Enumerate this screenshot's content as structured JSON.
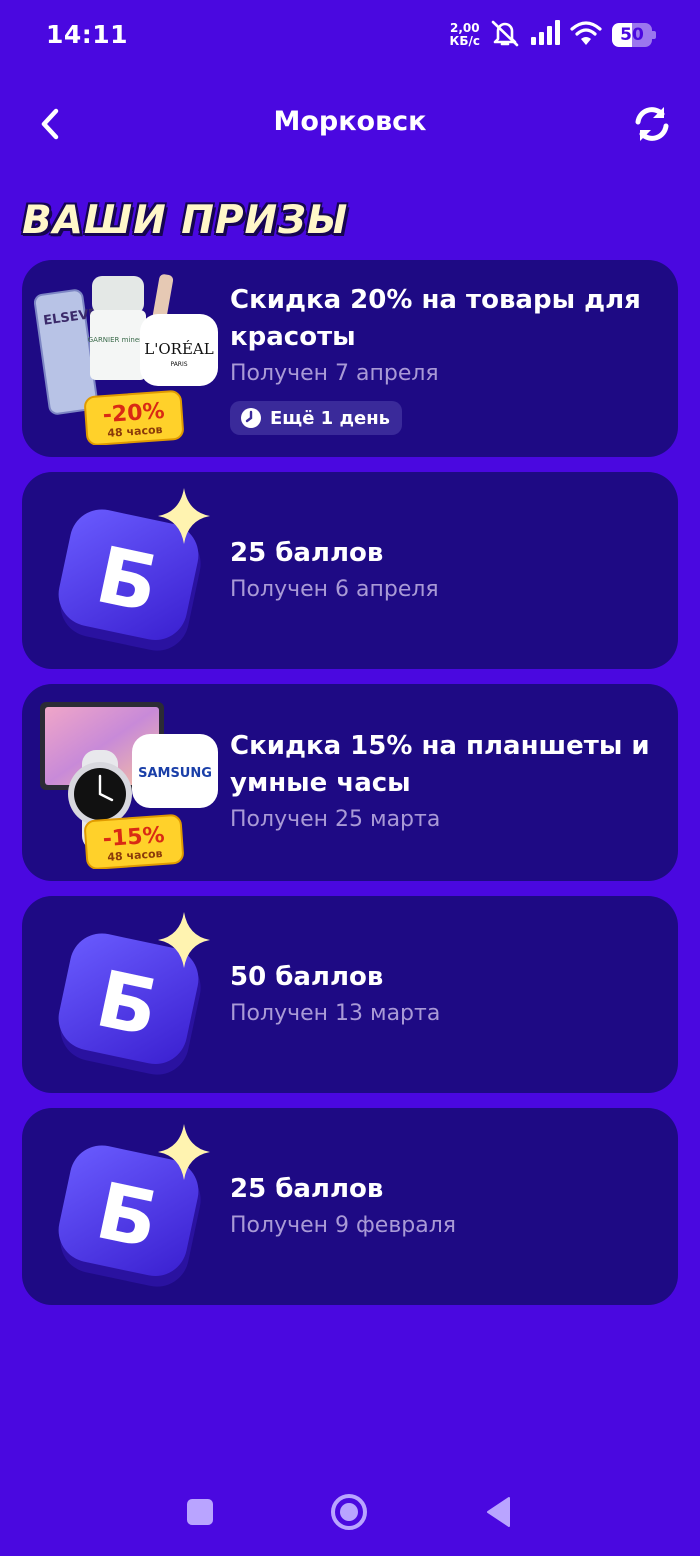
{
  "status_bar": {
    "time": "14:11",
    "speed_value": "2,00",
    "speed_unit": "КБ/с",
    "battery": "50",
    "battery_level": 0.5,
    "icons": [
      "mute-icon",
      "signal-icon",
      "wifi-icon",
      "battery-icon"
    ]
  },
  "header": {
    "title": "Морковск",
    "back_icon": "chevron-left-icon",
    "refresh_icon": "refresh-icon"
  },
  "section_title": "ВАШИ ПРИЗЫ",
  "colors": {
    "background": "#4a08e0",
    "card": "#1e0a84",
    "title_yellow": "#fff7c9",
    "subtitle": "#a99ad6",
    "discount_yellow": "#ffd12a",
    "discount_red": "#d92a14"
  },
  "prizes": [
    {
      "title": "Скидка 20% на товары для красоты",
      "received": "Получен 7 апреля",
      "badge": "Ещё 1 день",
      "image": "beauty-products-image",
      "discount_label": "-20%",
      "discount_duration": "48 часов",
      "brand": "L'ORÉAL",
      "brand_sub": "PARIS",
      "product_labels": [
        "ELSEVE",
        "GARNIER mineral"
      ]
    },
    {
      "title": "25 баллов",
      "received": "Получен 6 апреля",
      "image": "points-b-icon",
      "glyph": "Б"
    },
    {
      "title": "Скидка 15% на планшеты и умные часы",
      "received": "Получен 25 марта",
      "image": "tablet-watch-image",
      "discount_label": "-15%",
      "discount_duration": "48 часов",
      "brand": "SAMSUNG"
    },
    {
      "title": "50 баллов",
      "received": "Получен 13 марта",
      "image": "points-b-icon",
      "glyph": "Б"
    },
    {
      "title": "25 баллов",
      "received": "Получен 9 февраля",
      "image": "points-b-icon",
      "glyph": "Б"
    }
  ],
  "nav": {
    "icons": [
      "square-icon",
      "circle-home-icon",
      "triangle-back-icon"
    ]
  }
}
